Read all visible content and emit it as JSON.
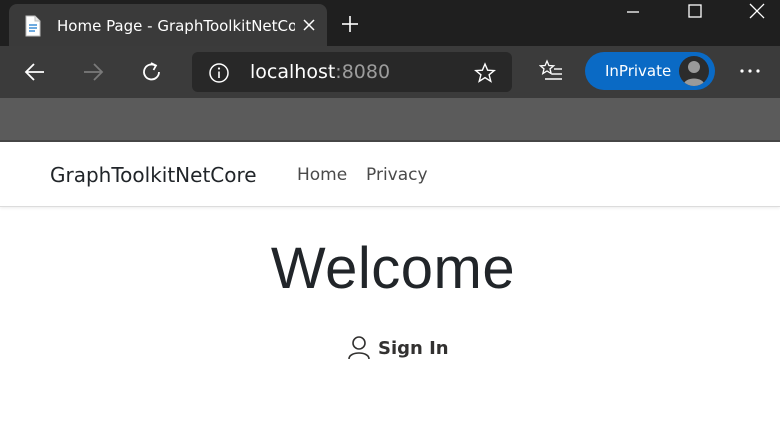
{
  "browser": {
    "tab": {
      "title": "Home Page - GraphToolkitNetCore",
      "favicon": "page-icon"
    },
    "address": {
      "host": "localhost",
      "port": ":8080"
    },
    "profile": {
      "label": "InPrivate"
    },
    "colors": {
      "titlebar": "#1f1f1f",
      "toolbar": "#3b3b3b",
      "inprivate_accent": "#0a6ac5"
    }
  },
  "site": {
    "brand": "GraphToolkitNetCore",
    "nav": [
      {
        "label": "Home"
      },
      {
        "label": "Privacy"
      }
    ]
  },
  "main": {
    "heading": "Welcome",
    "signin": {
      "label": "Sign In",
      "icon": "person-icon"
    }
  }
}
